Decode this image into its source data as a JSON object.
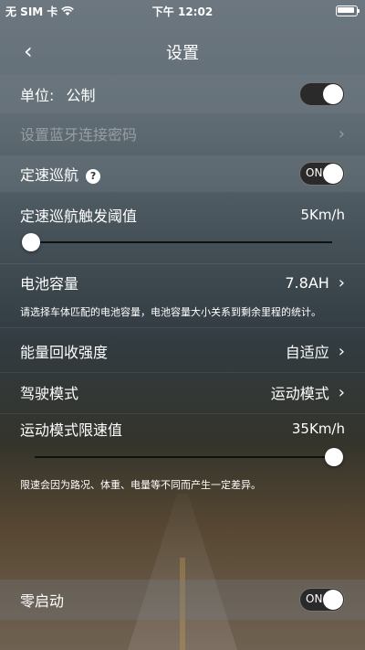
{
  "status_bar": {
    "carrier": "无 SIM 卡",
    "time": "下午 12:02"
  },
  "nav": {
    "title": "设置"
  },
  "unit": {
    "label": "单位:",
    "value": "公制"
  },
  "bluetooth_password": {
    "label": "设置蓝牙连接密码"
  },
  "cruise": {
    "label": "定速巡航",
    "help": "?",
    "toggle_label": "ON"
  },
  "cruise_threshold": {
    "label": "定速巡航触发阈值",
    "value": "5Km/h",
    "slider_level": 0.0
  },
  "battery": {
    "label": "电池容量",
    "value": "7.8AH",
    "note": "请选择车体匹配的电池容量，电池容量大小关系到剩余里程的统计。"
  },
  "regen": {
    "label": "能量回收强度",
    "value": "自适应"
  },
  "drive_mode": {
    "label": "驾驶模式",
    "value": "运动模式"
  },
  "sport_speed_limit": {
    "label": "运动模式限速值",
    "value": "35Km/h",
    "slider_level": 1.0,
    "note": "限速会因为路况、体重、电量等不同而产生一定差异。"
  },
  "zero_start": {
    "label": "零启动",
    "toggle_label": "ON"
  }
}
